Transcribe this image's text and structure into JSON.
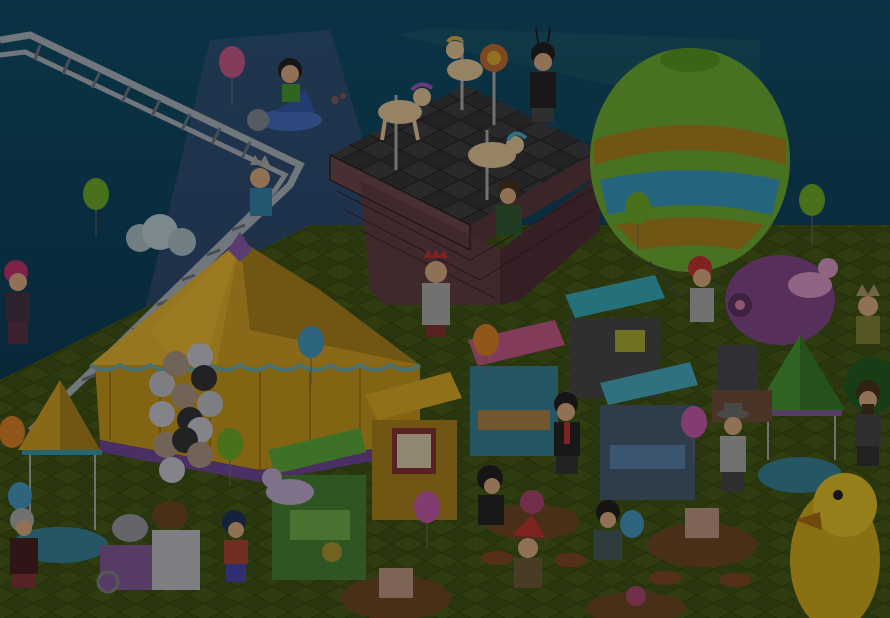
{
  "scene": {
    "type": "isometric-game-room",
    "theme": "funfair",
    "dimmed": true,
    "colors": {
      "sky_top": "#0d3f55",
      "sky_bottom": "#0a2a3c",
      "grass": "#3a4a14",
      "grass_dark": "#2a370e",
      "tent_yellow": "#c49a2a",
      "tent_purple": "#6f4a8c",
      "balloon_green": "#6a9a2a",
      "balloon_blue": "#3f8aa8",
      "balloon_orange": "#b06a20"
    },
    "stalls": [
      {
        "name": "popcorn-stall",
        "roof": "#b08a20"
      },
      {
        "name": "candy-stall",
        "roof": "#a0486e"
      },
      {
        "name": "snack-stall",
        "roof": "#2e8a94"
      },
      {
        "name": "sweets-stall",
        "roof": "#3a8a9a"
      },
      {
        "name": "drinks-stall",
        "roof": "#4a8a30"
      }
    ],
    "avatars": [
      {
        "name": "avatar-pilot"
      },
      {
        "name": "avatar-crown"
      },
      {
        "name": "avatar-antenna"
      },
      {
        "name": "avatar-carousel-rider"
      },
      {
        "name": "avatar-king"
      },
      {
        "name": "avatar-pink-hair"
      },
      {
        "name": "avatar-red-hair"
      },
      {
        "name": "avatar-suit"
      },
      {
        "name": "avatar-black-hood"
      },
      {
        "name": "avatar-santa-hat"
      },
      {
        "name": "avatar-headphones"
      },
      {
        "name": "avatar-grey-hair"
      },
      {
        "name": "avatar-fedora"
      },
      {
        "name": "avatar-bearded"
      },
      {
        "name": "avatar-spiky"
      },
      {
        "name": "avatar-blue-hair"
      }
    ]
  }
}
